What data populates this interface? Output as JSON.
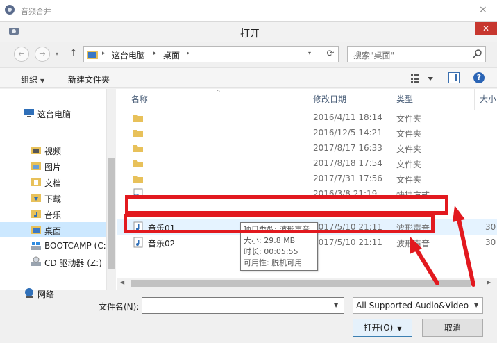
{
  "parent_window": {
    "title": "音频合并",
    "close_glyph": "×"
  },
  "dialog": {
    "title": "打开",
    "close_glyph": "✕"
  },
  "address_bar": {
    "crumbs": [
      "这台电脑",
      "桌面"
    ],
    "separator": "▸",
    "search_placeholder": "搜索\"桌面\""
  },
  "nav_buttons": {
    "back": "←",
    "forward": "→",
    "up": "↑",
    "refresh": "⟳",
    "dropdown": "▾"
  },
  "toolbar": {
    "organize": "组织",
    "new_folder": "新建文件夹",
    "help": "?"
  },
  "nav_pane": {
    "items": [
      {
        "label": "这台电脑",
        "icon": "computer-icon"
      },
      {
        "label": "视频",
        "icon": "folder-icon"
      },
      {
        "label": "图片",
        "icon": "folder-icon"
      },
      {
        "label": "文档",
        "icon": "folder-icon"
      },
      {
        "label": "下载",
        "icon": "folder-icon"
      },
      {
        "label": "音乐",
        "icon": "folder-icon"
      },
      {
        "label": "桌面",
        "icon": "folder-icon",
        "selected": true
      },
      {
        "label": "BOOTCAMP (C:",
        "icon": "drive-icon"
      },
      {
        "label": "CD 驱动器 (Z:)",
        "icon": "cd-drive-icon"
      },
      {
        "label": "网络",
        "icon": "network-icon"
      }
    ]
  },
  "file_list": {
    "columns": [
      "名称",
      "修改日期",
      "类型",
      "大小"
    ],
    "sort_indicator": "^",
    "rows": [
      {
        "name": "",
        "date": "2016/4/11 18:14",
        "type": "文件夹",
        "size": "",
        "icon": "folder-icon"
      },
      {
        "name": "",
        "date": "2016/12/5 14:21",
        "type": "文件夹",
        "size": "",
        "icon": "folder-icon"
      },
      {
        "name": "",
        "date": "2017/8/17 16:33",
        "type": "文件夹",
        "size": "",
        "icon": "folder-icon"
      },
      {
        "name": "",
        "date": "2017/8/18 17:54",
        "type": "文件夹",
        "size": "",
        "icon": "folder-icon"
      },
      {
        "name": "",
        "date": "2017/7/31 17:56",
        "type": "文件夹",
        "size": "",
        "icon": "folder-icon"
      },
      {
        "name": "",
        "date": "2016/3/8 21:19",
        "type": "快捷方式",
        "size": "",
        "icon": "shortcut-icon"
      },
      {
        "name": "音乐01",
        "date": "2017/5/10 21:11",
        "type": "波形声音",
        "size": "30",
        "icon": "audio-file-icon",
        "highlight": true
      },
      {
        "name": "音乐02",
        "date": "2017/5/10 21:11",
        "type": "波形声音",
        "size": "30",
        "icon": "audio-file-icon"
      }
    ]
  },
  "tooltip": {
    "lines": [
      "项目类型: 波形声音",
      "大小: 29.8 MB",
      "时长: 00:05:55",
      "可用性: 脱机可用"
    ]
  },
  "bottom": {
    "filename_label": "文件名(N):",
    "filename_value": "",
    "filetype_value": "All Supported Audio&Video",
    "open_button": "打开(O)",
    "cancel_button": "取消"
  },
  "colors": {
    "annotation_red": "#e2191f",
    "selection_blue": "#cce8ff",
    "hover_blue": "#e5f3ff"
  }
}
